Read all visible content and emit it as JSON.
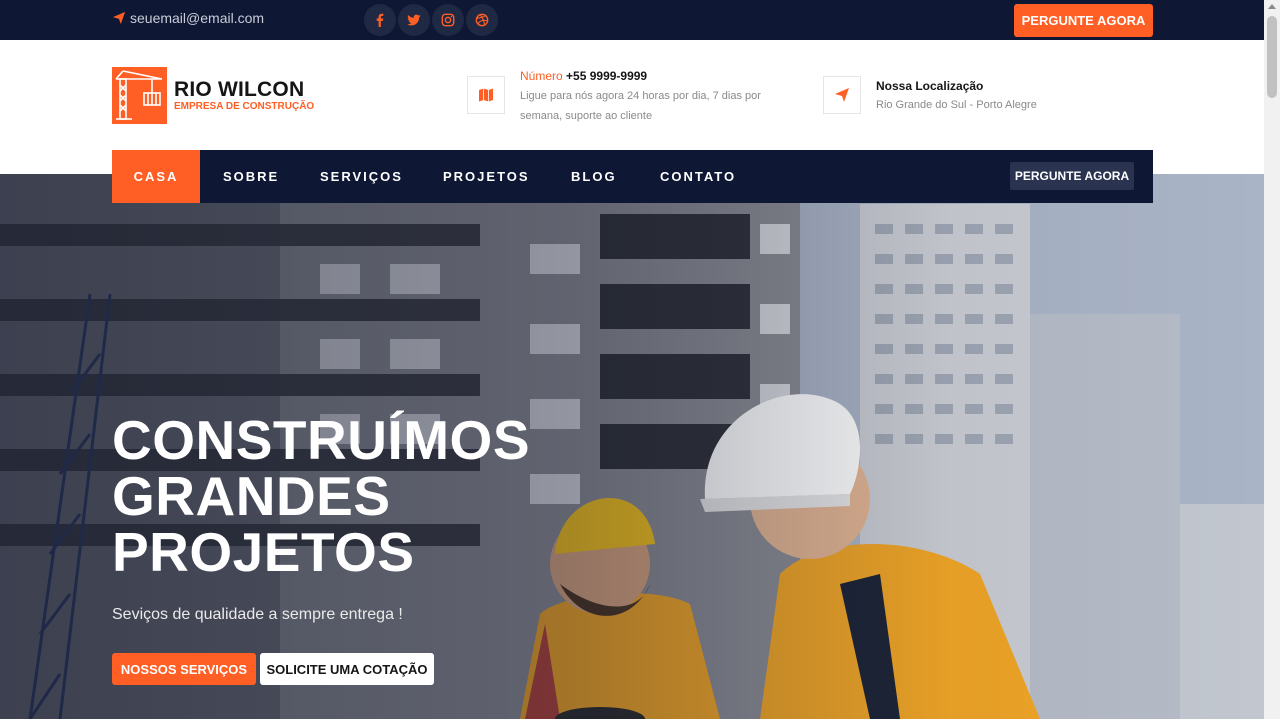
{
  "topbar": {
    "email": "seuemail@email.com",
    "socials": [
      "facebook-icon",
      "twitter-icon",
      "instagram-icon",
      "dribbble-icon"
    ],
    "cta": "PERGUNTE AGORA"
  },
  "brand": {
    "name": "RIO WILCON",
    "tagline": "EMPRESA DE CONSTRUÇÃO"
  },
  "contact": {
    "phone_label": "Número",
    "phone_number": "+55 9999-9999",
    "phone_text": "Ligue para nós agora 24 horas por dia, 7 dias por semana, suporte ao cliente",
    "location_title": "Nossa Localização",
    "location_text": "Rio Grande do Sul - Porto Alegre"
  },
  "nav": {
    "items": [
      "CASA",
      "SOBRE",
      "SERVIÇOS",
      "PROJETOS",
      "BLOG",
      "CONTATO"
    ],
    "active": "CASA",
    "cta": "PERGUNTE AGORA"
  },
  "hero": {
    "title_lines": [
      "CONSTRUÍMOS",
      "GRANDES",
      "PROJETOS"
    ],
    "subtitle": "Seviços de qualidade a sempre entrega !",
    "primary_button": "NOSSOS SERVIÇOS",
    "secondary_button": "SOLICITE UMA COTAÇÃO"
  },
  "colors": {
    "accent": "#ff5e24",
    "navy": "#0e1734"
  }
}
